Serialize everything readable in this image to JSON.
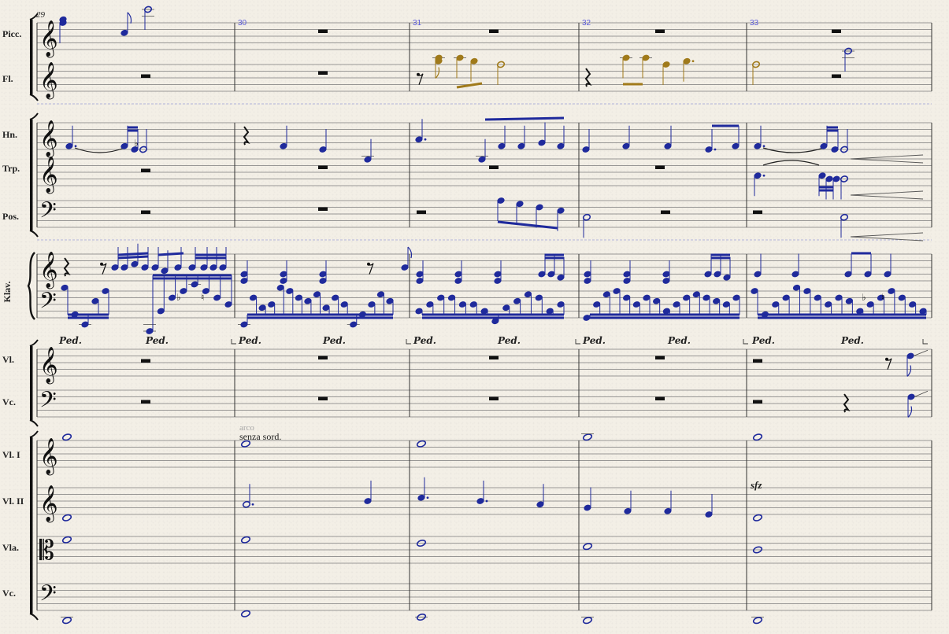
{
  "score": {
    "first_measure": "29",
    "measure_numbers": [
      "29",
      "30",
      "31",
      "32",
      "33"
    ],
    "instruments": [
      {
        "key": "picc",
        "label": "Picc."
      },
      {
        "key": "fl",
        "label": "Fl."
      },
      {
        "key": "hn",
        "label": "Hn."
      },
      {
        "key": "trp",
        "label": "Trp."
      },
      {
        "key": "pos",
        "label": "Pos."
      },
      {
        "key": "klav",
        "label": "Klav."
      },
      {
        "key": "vl",
        "label": "Vl."
      },
      {
        "key": "vc",
        "label": "Vc."
      },
      {
        "key": "vl1",
        "label": "Vl. I"
      },
      {
        "key": "vl2",
        "label": "Vl. II"
      },
      {
        "key": "vla",
        "label": "Vla."
      },
      {
        "key": "vc2",
        "label": "Vc."
      }
    ],
    "pedal_mark": "Ped.",
    "technique_arco": "arco",
    "technique_senza": "senza sord.",
    "dynamic_sfz": "sfz",
    "colors": {
      "selected_note": "#1f2a9c",
      "highlight_note": "#a07a1a",
      "measure_number": "#5a5ad8",
      "paper": "#f3efe6"
    }
  }
}
